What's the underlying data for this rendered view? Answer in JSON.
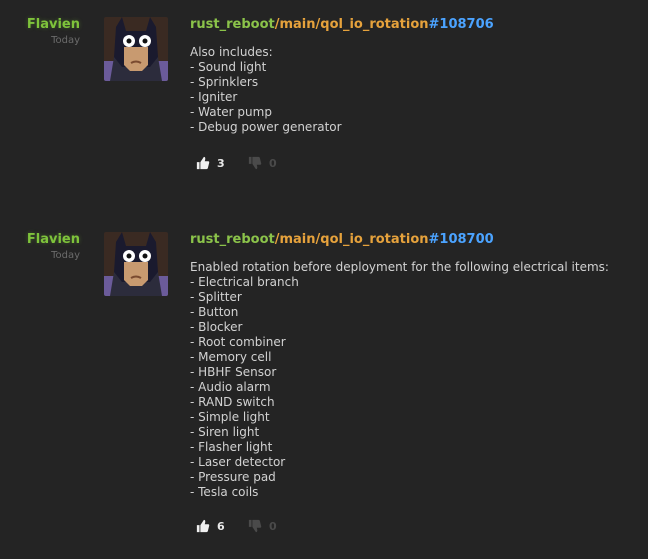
{
  "colors": {
    "background": "#242424",
    "author": "#7ec33b",
    "repo": "#8bc34a",
    "branch": "#e6a23c",
    "hash": "#4ba3ff",
    "text": "#d2d2d2"
  },
  "posts": [
    {
      "author": "Flavien",
      "time": "Today",
      "avatar_icon": "batman-avatar",
      "repo": "rust_reboot",
      "branch": "/main/qol_io_rotation",
      "hash": "#108706",
      "message": [
        "Also includes:",
        "- Sound light",
        "- Sprinklers",
        "- Igniter",
        "- Water pump",
        "- Debug power generator"
      ],
      "upvotes": "3",
      "downvotes": "0"
    },
    {
      "author": "Flavien",
      "time": "Today",
      "avatar_icon": "batman-avatar",
      "repo": "rust_reboot",
      "branch": "/main/qol_io_rotation",
      "hash": "#108700",
      "message": [
        "Enabled rotation before deployment for the following electrical items:",
        "- Electrical branch",
        "- Splitter",
        "- Button",
        "- Blocker",
        "- Root combiner",
        "- Memory cell",
        "- HBHF Sensor",
        "- Audio alarm",
        "- RAND switch",
        "- Simple light",
        "- Siren light",
        "- Flasher light",
        "- Laser detector",
        "- Pressure pad",
        "- Tesla coils"
      ],
      "upvotes": "6",
      "downvotes": "0"
    }
  ]
}
